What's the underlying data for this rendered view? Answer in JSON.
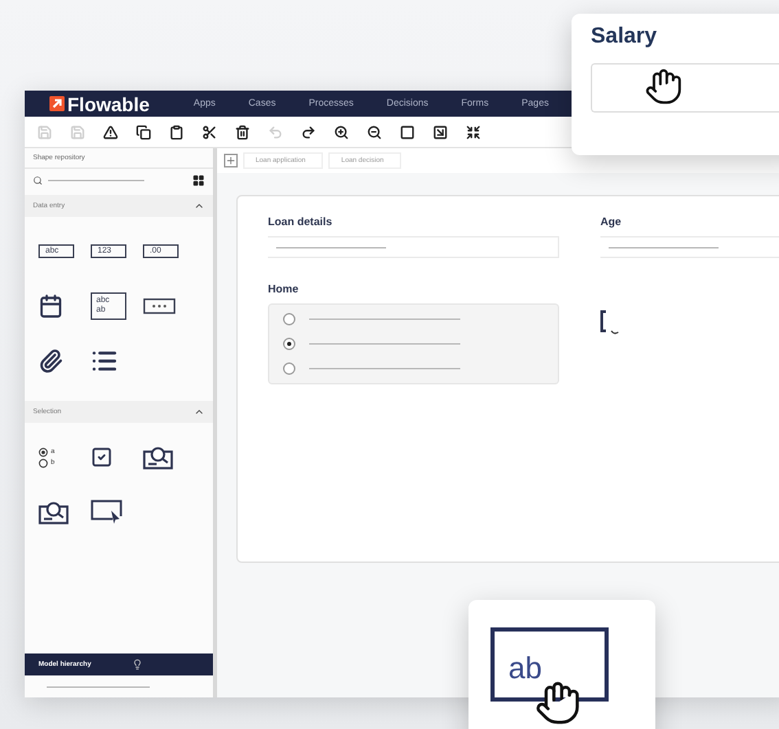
{
  "nav": {
    "logo": "Flowable",
    "items": [
      "Apps",
      "Cases",
      "Processes",
      "Decisions",
      "Forms",
      "Pages"
    ]
  },
  "sidebar": {
    "title": "Shape repository",
    "sections": [
      {
        "title": "Data entry",
        "expanded": true,
        "items": [
          {
            "kind": "text",
            "lines": [
              "abc"
            ]
          },
          {
            "kind": "text",
            "lines": [
              "123"
            ]
          },
          {
            "kind": "text",
            "lines": [
              ".00"
            ]
          },
          {
            "kind": "date"
          },
          {
            "kind": "text",
            "lines": [
              "abc",
              "ab"
            ]
          },
          {
            "kind": "password"
          },
          {
            "kind": "attachment"
          },
          {
            "kind": "list"
          }
        ]
      },
      {
        "title": "Selection",
        "expanded": true,
        "items": [
          {
            "kind": "radio",
            "lines": [
              "a",
              "b"
            ]
          },
          {
            "kind": "checkbox"
          },
          {
            "kind": "lookup"
          },
          {
            "kind": "lookup"
          },
          {
            "kind": "select"
          }
        ]
      }
    ],
    "hierarchy": {
      "title": "Model hierarchy"
    }
  },
  "tabs": [
    {
      "label": "Loan application",
      "selected": false
    },
    {
      "label": "Loan decision",
      "selected": false
    }
  ],
  "form": {
    "fields": [
      {
        "kind": "input",
        "label": "Loan details"
      },
      {
        "kind": "input",
        "label": "Age"
      },
      {
        "kind": "radio",
        "label": "Home",
        "options": [
          {
            "selected": false
          },
          {
            "selected": true
          },
          {
            "selected": false
          }
        ]
      },
      {
        "kind": "drop"
      }
    ]
  },
  "salary_card": {
    "label": "Salary"
  },
  "drag_card": {
    "text": "ab"
  }
}
